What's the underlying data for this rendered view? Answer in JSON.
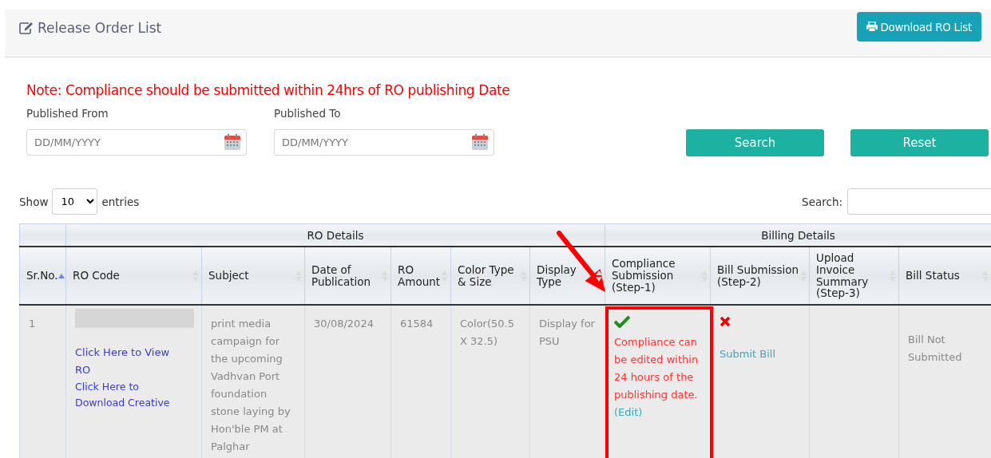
{
  "header": {
    "title": "Release Order List",
    "download_button": "Download RO List"
  },
  "note": "Note: Compliance should be submitted within 24hrs of RO publishing Date",
  "filters": [
    {
      "label": "Published From",
      "placeholder": "DD/MM/YYYY"
    },
    {
      "label": "Published To",
      "placeholder": "DD/MM/YYYY"
    }
  ],
  "buttons": [
    "Search",
    "Reset"
  ],
  "length_control": {
    "before": "Show",
    "value": "10",
    "after": "entries"
  },
  "search": {
    "label": "Search:"
  },
  "table": {
    "groups": [
      {
        "label": "RO Details"
      },
      {
        "label": "Billing Details"
      }
    ],
    "columns": [
      {
        "label": "Sr.No.",
        "sorted": true
      },
      {
        "label": "RO Code",
        "sorted": false
      },
      {
        "label": "Subject",
        "sorted": false
      },
      {
        "label": "Date of Publication",
        "sorted": false
      },
      {
        "label": "RO Amount",
        "sorted": false
      },
      {
        "label": "Color Type & Size",
        "sorted": false
      },
      {
        "label": "Display Type",
        "sorted": false
      },
      {
        "label": "Compliance Submission (Step-1)",
        "sorted": false
      },
      {
        "label": "Bill Submission (Step-2)",
        "sorted": false
      },
      {
        "label": "Upload Invoice Summary (Step-3)",
        "sorted": false
      },
      {
        "label": "Bill Status",
        "sorted": false
      }
    ],
    "rows": [
      {
        "sr": "1",
        "ro_links": [
          "Click Here to View RO",
          "Click Here to Download Creative"
        ],
        "subject": "print media campaign for the upcoming Vadhvan Port foundation stone laying by Hon'ble PM at Palghar",
        "date": "30/08/2024",
        "amount": "61584",
        "color_size": "Color(50.5 X 32.5)",
        "display_type": "Display for PSU",
        "compliance": {
          "done": true,
          "note": "Compliance can be edited within 24 hours of the publishing date.",
          "edit_link": "(Edit)",
          "highlighted": true
        },
        "bill": {
          "done": false,
          "link": "Submit Bill"
        },
        "bill_status": "Bill Not Submitted"
      }
    ]
  }
}
